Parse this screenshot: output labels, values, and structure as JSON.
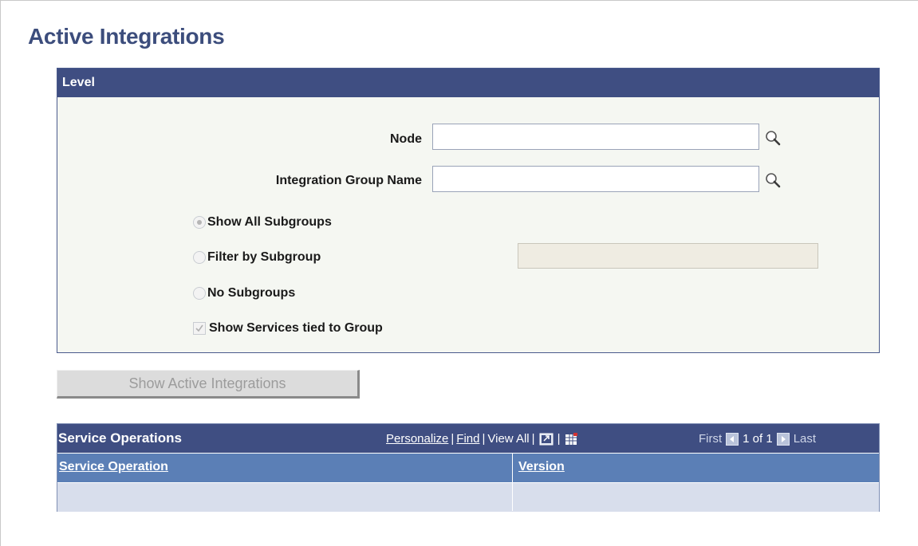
{
  "page": {
    "title": "Active Integrations"
  },
  "level_section": {
    "header": "Level",
    "node_label": "Node",
    "node_value": "",
    "group_label": "Integration Group Name",
    "group_value": "",
    "radio_options": [
      {
        "label": "Show All Subgroups",
        "checked": true
      },
      {
        "label": "Filter by Subgroup",
        "checked": false
      },
      {
        "label": "No Subgroups",
        "checked": false
      }
    ],
    "checkbox_label": "Show Services tied to Group",
    "checkbox_checked": true,
    "subgroup_value": ""
  },
  "actions": {
    "show_button": "Show Active Integrations"
  },
  "grid": {
    "title": "Service Operations",
    "nav": {
      "personalize": "Personalize",
      "find": "Find",
      "view_all": "View All",
      "first": "First",
      "range": "1 of 1",
      "last": "Last"
    },
    "columns": [
      "Service Operation",
      "Version"
    ],
    "rows": [
      [
        "",
        ""
      ]
    ]
  },
  "colors": {
    "title": "#3c4d7c",
    "header_bar": "#3f4e82",
    "column_header": "#5b7fb6",
    "row_bg": "#d8deec"
  }
}
